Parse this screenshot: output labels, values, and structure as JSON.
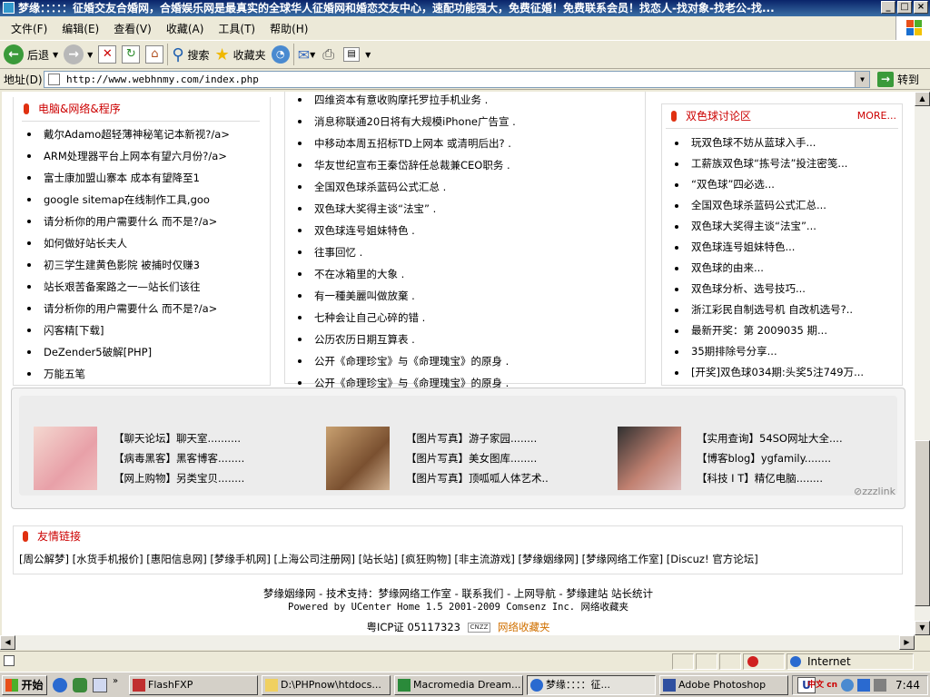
{
  "window": {
    "title": "梦缘：：：：：征婚交友合婚网，合婚娱乐网是最真实的全球华人征婚网和婚恋交友中心，速配功能强大，免费征婚！免费联系会员！找恋人-找对象-找老公-找...",
    "controls": [
      "_",
      "□",
      "×"
    ]
  },
  "menubar": [
    "文件(F)",
    "编辑(E)",
    "查看(V)",
    "收藏(A)",
    "工具(T)",
    "帮助(H)"
  ],
  "toolbar": {
    "back": "后退",
    "search": "搜索",
    "favorites": "收藏夹"
  },
  "addressbar": {
    "label": "地址(D)",
    "url": "http://www.webhnmy.com/index.php",
    "go": "转到"
  },
  "left_panel": {
    "title": "电脑&网络&程序",
    "items": [
      "戴尔Adamo超轻薄神秘笔记本新视?/a>",
      "ARM处理器平台上网本有望六月份?/a>",
      "富士康加盟山寨本 成本有望降至1",
      "google sitemap在线制作工具,goo",
      "请分析你的用户需要什么 而不是?/a>",
      "如何做好站长夫人",
      "初三学生建黄色影院 被捕时仅赚3",
      "站长艰苦备案路之一—站长们该往",
      "请分析你的用户需要什么 而不是?/a>",
      "闪客精[下载]",
      "DeZender5破解[PHP]",
      "万能五笔"
    ]
  },
  "middle_panel": {
    "items": [
      "四维资本有意收购摩托罗拉手机业务 .",
      "消息称联通20日将有大规模iPhone广告宣 .",
      "中移动本周五招标TD上网本 或清明后出? .",
      "华友世纪宣布王秦岱辞任总裁兼CEO职务 .",
      "全国双色球杀蓝码公式汇总 .",
      "双色球大奖得主谈“法宝” .",
      "双色球连号姐妹特色 .",
      "往事回忆 .",
      "不在冰箱里的大象 .",
      "有一種美麗叫做放棄 .",
      "七种会让自己心碎的错 .",
      "公历农历日期互算表 .",
      "公开《命理珍宝》与《命理瑰宝》的原身 .",
      "公开《命理珍宝》与《命理瑰宝》的原身 ."
    ]
  },
  "right_panel": {
    "title": "双色球讨论区",
    "more": "MORE...",
    "items": [
      "玩双色球不妨从蓝球入手...",
      "工薪族双色球“拣号法”投注密笺...",
      "“双色球”四必选...",
      "全国双色球杀蓝码公式汇总...",
      "双色球大奖得主谈“法宝”...",
      "双色球连号姐妹特色...",
      "双色球的由来...",
      "双色球分析、选号技巧...",
      "浙江彩民自制选号机 自改机选号?..",
      "最新开奖：第 2009035 期...",
      "35期排除号分享...",
      "[开奖]双色球034期:头奖5注749万..."
    ]
  },
  "ads": {
    "groups": [
      [
        "【聊天论坛】聊天室..........",
        "【病毒黑客】黑客博客........",
        "【网上购物】另类宝贝........"
      ],
      [
        "【图片写真】游子家园........",
        "【图片写真】美女图库........",
        "【图片写真】顶呱呱人体艺术.."
      ],
      [
        "【实用查询】54SO网址大全....",
        "【博客blog】ygfamily........",
        "【科技 I T】精亿电脑........"
      ]
    ],
    "brand": "zzzlink"
  },
  "friends": {
    "title": "友情链接",
    "links": "[周公解梦] [水货手机报价] [惠阳信息网] [梦缘手机网] [上海公司注册网] [站长站] [疯狂购物] [非主流游戏] [梦缘姻缘网] [梦缘网络工作室] [Discuz! 官方论坛]"
  },
  "footer": {
    "line1": "梦缘姻缘网 - 技术支持：梦缘网络工作室 - 联系我们 - 上网导航 - 梦缘建站 站长统计",
    "line2": "Powered by UCenter Home 1.5 2001-2009 Comsenz Inc. 网络收藏夹",
    "icp": "粤ICP证 05117323",
    "cnzz": "CNZZ",
    "fav": "网络收藏夹"
  },
  "status": {
    "zone": "Internet"
  },
  "taskbar": {
    "start": "开始",
    "tasks": [
      "FlashFXP",
      "D:\\PHPnow\\htdocs...",
      "Macromedia Dream...",
      "梦缘：：：：征...",
      "Adobe Photoshop"
    ],
    "time": "7:44",
    "ime": "中文 cn"
  }
}
